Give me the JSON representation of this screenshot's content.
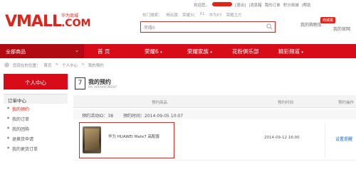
{
  "topbar": {
    "welcome": "欢迎您，",
    "logout": "[退出]",
    "msg": "|消息箱",
    "orders": "我的订单",
    "points": "积分商城",
    "help": "|帮助"
  },
  "header": {
    "logo_main": "VMALL",
    "logo_com": ".COM",
    "logo_cn": "华为商城",
    "hot_label": "热门搜索：",
    "hot_words": [
      "畅玩版",
      "荣耀3C",
      "X1",
      "华为P7",
      "荣耀立方"
    ],
    "search_value": "荣耀6",
    "cart_label": "我的购物车",
    "cart_badge": "商城报",
    "cart_label2": "我的官网"
  },
  "nav": {
    "all_label": "全部商品",
    "items": [
      {
        "label": "首 页"
      },
      {
        "label": "荣耀6"
      },
      {
        "label": "荣耀家族"
      },
      {
        "label": "花粉俱乐部"
      },
      {
        "label": "精彩频道"
      }
    ]
  },
  "breadcrumb": {
    "prefix": "您现在的位置：",
    "items": [
      "首页",
      ">",
      "个人中心",
      ">",
      "我的预约"
    ]
  },
  "sidebar": {
    "head": "个人中心",
    "group": "订单中心",
    "items": [
      {
        "label": "我的预约",
        "active": true
      },
      {
        "label": "我的订单"
      },
      {
        "label": "我的团购"
      },
      {
        "label": "退换货申请"
      },
      {
        "label": "我的更货订单"
      }
    ]
  },
  "main": {
    "icon_char": "7",
    "title": "我的预约",
    "subtitle": "MY APPOINTMENT",
    "columns": [
      "预约商品",
      "预约时间",
      "预约操作"
    ],
    "row": {
      "id_label": "预约活动ID：38",
      "time_label": "预约时间：2014-09-05 10:07",
      "product": "华为 HUAWEI Mate7 高配版",
      "time": "2014-09-12 16:00",
      "action": "设置提醒"
    }
  }
}
